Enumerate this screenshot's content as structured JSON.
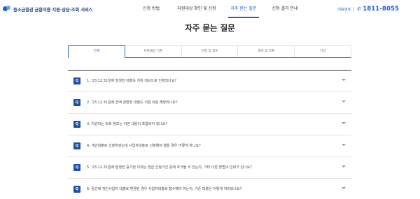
{
  "header": {
    "logo_text": "중소금융권 금융이용 지원·상담·조회 서비스",
    "nav": [
      "신청 방법",
      "지원대상 확인 및 신청",
      "자주 묻는 질문",
      "신청 결과 안내"
    ],
    "contact_label": "대표번호",
    "contact_number": "1811-8055"
  },
  "page": {
    "title": "자주 묻는 질문"
  },
  "tabs": [
    {
      "label": "전체",
      "active": true
    },
    {
      "label": "지원대상 기준",
      "active": false
    },
    {
      "label": "신청 및 접수",
      "active": false
    },
    {
      "label": "결과 및 조회",
      "active": false
    },
    {
      "label": "기타",
      "active": false
    }
  ],
  "faq": [
    {
      "badge": "Q",
      "question": "1. '23.12.31일에 발생한 대출도 지원 대상으로 인정되나요?"
    },
    {
      "badge": "Q",
      "question": "2. '23.12.31일에 전액 상환한 대출도 지원 대상 해당되나요?"
    },
    {
      "badge": "Q",
      "question": "3. 지원되는 조회 정보는 어떤 내용이 포함되어 있나요?"
    },
    {
      "badge": "Q",
      "question": "4. 개인대출로 신청하였는데 사업자대출로 신청해야 했을 경우 어떻게 하나요?"
    },
    {
      "badge": "Q",
      "question": "5. '23.12.31일에 발생한 증가된 이자는 환급 신청기간 중에 추가될 수 있는지, 기타 다른 방법의 안내가 있나요?"
    },
    {
      "badge": "Q",
      "question": "6. 중간에 개인사업자 대출로 변경된 경우 사업자대출로 접수해야 하는지, 기존 대출은 어떻게 처리되나요?"
    }
  ]
}
